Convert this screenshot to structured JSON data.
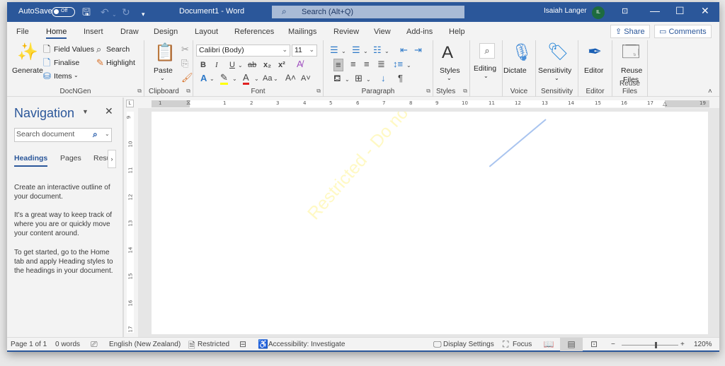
{
  "titlebar": {
    "autosave_label": "AutoSave",
    "autosave_state": "Off",
    "document_title": "Document1  -  Word",
    "search_placeholder": "Search (Alt+Q)",
    "user_name": "Isaiah Langer",
    "user_initials": "IL",
    "icons": [
      "save-icon",
      "undo-icon",
      "redo-icon",
      "customize-qat-icon",
      "ribbon-display-icon",
      "minimize-icon",
      "maximize-icon",
      "close-icon"
    ]
  },
  "tabs": [
    "File",
    "Home",
    "Insert",
    "Draw",
    "Design",
    "Layout",
    "References",
    "Mailings",
    "Review",
    "View",
    "Add-ins",
    "Help"
  ],
  "active_tab": "Home",
  "share_label": "Share",
  "comments_label": "Comments",
  "ribbon": {
    "docngen": {
      "label": "DocNGen",
      "generate": "Generate",
      "field_values": "Field Values",
      "finalise": "Finalise",
      "items": "Items",
      "search": "Search",
      "highlight": "Highlight"
    },
    "clipboard": {
      "label": "Clipboard",
      "paste": "Paste"
    },
    "font": {
      "label": "Font",
      "font_name": "Calibri (Body)",
      "font_size": "11",
      "bold": "B",
      "italic": "I",
      "underline": "U",
      "strike": "ab",
      "subscript": "x₂",
      "superscript": "x²",
      "change_case": "Aa",
      "grow": "A˄",
      "shrink": "A˅",
      "highlight_color": "#ffff00",
      "font_color": "#e02020"
    },
    "paragraph": {
      "label": "Paragraph"
    },
    "styles": {
      "label": "Styles",
      "button": "Styles"
    },
    "editing": {
      "button": "Editing"
    },
    "voice": {
      "label": "Voice",
      "button": "Dictate"
    },
    "sensitivity": {
      "label": "Sensitivity",
      "button": "Sensitivity"
    },
    "editor": {
      "label": "Editor",
      "button": "Editor"
    },
    "reuse": {
      "label": "Reuse Files",
      "button_line1": "Reuse",
      "button_line2": "Files"
    }
  },
  "navigation": {
    "title": "Navigation",
    "search_placeholder": "Search document",
    "tabs": [
      "Headings",
      "Pages",
      "Resu"
    ],
    "active_tab": "Headings",
    "para1": "Create an interactive outline of your document.",
    "para2": "It's a great way to keep track of where you are or quickly move your content around.",
    "para3": "To get started, go to the Home tab and apply Heading styles to the headings in your document."
  },
  "ruler": {
    "horizontal_ticks": [
      "1",
      "1",
      "2",
      "3",
      "4",
      "5",
      "6",
      "7",
      "8",
      "9",
      "10",
      "11",
      "12",
      "13",
      "14",
      "15",
      "16",
      "17",
      "19"
    ],
    "vertical_ticks": [
      "9",
      "10",
      "11",
      "12",
      "13",
      "14",
      "15",
      "16",
      "17"
    ]
  },
  "document": {
    "watermark": "Restricted - Do not share externally",
    "watermark_color": "#fff9c4"
  },
  "status": {
    "page": "Page 1 of 1",
    "words": "0 words",
    "language": "English (New Zealand)",
    "sensitivity": "Restricted",
    "accessibility": "Accessibility: Investigate",
    "display_settings": "Display Settings",
    "focus": "Focus",
    "zoom_percent": "120%",
    "zoom_slider_fraction": 0.6
  },
  "colors": {
    "brand": "#2b579a"
  }
}
